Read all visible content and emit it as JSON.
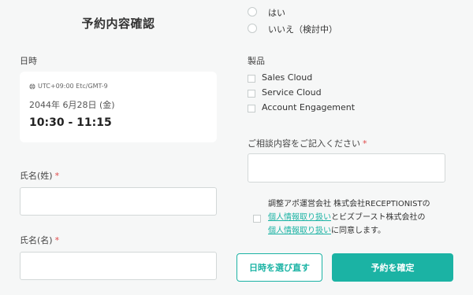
{
  "title": "予約内容確認",
  "schedule": {
    "label": "日時",
    "timezone": "UTC+09:00 Etc/GMT-9",
    "date": "2044年 6月28日 (金)",
    "time": "10:30 - 11:15"
  },
  "last_name": {
    "label": "氏名(姓)",
    "required_mark": "*",
    "value": ""
  },
  "first_name": {
    "label": "氏名(名)",
    "required_mark": "*",
    "value": ""
  },
  "radio_options": [
    {
      "label": "はい",
      "checked": false
    },
    {
      "label": "いいえ（検討中）",
      "checked": false
    }
  ],
  "products": {
    "label": "製品",
    "items": [
      {
        "label": "Sales Cloud",
        "checked": false
      },
      {
        "label": "Service Cloud",
        "checked": false
      },
      {
        "label": "Account Engagement",
        "checked": false
      }
    ]
  },
  "consultation": {
    "label": "ご相談内容をご記入ください",
    "required_mark": "*",
    "value": ""
  },
  "consent": {
    "line1": "調整アポ運営会社 株式会社RECEPTIONISTの",
    "link1": "個人情報取り扱い",
    "line2": "とビズブースト株式会社の",
    "link2": "個人情報取り扱い",
    "line3": "に同意します。",
    "checked": false
  },
  "buttons": {
    "reselect": "日時を選び直す",
    "confirm": "予約を確定"
  },
  "colors": {
    "accent": "#1bb3a4",
    "required": "#e04a4a",
    "background": "#f6f7f7"
  }
}
